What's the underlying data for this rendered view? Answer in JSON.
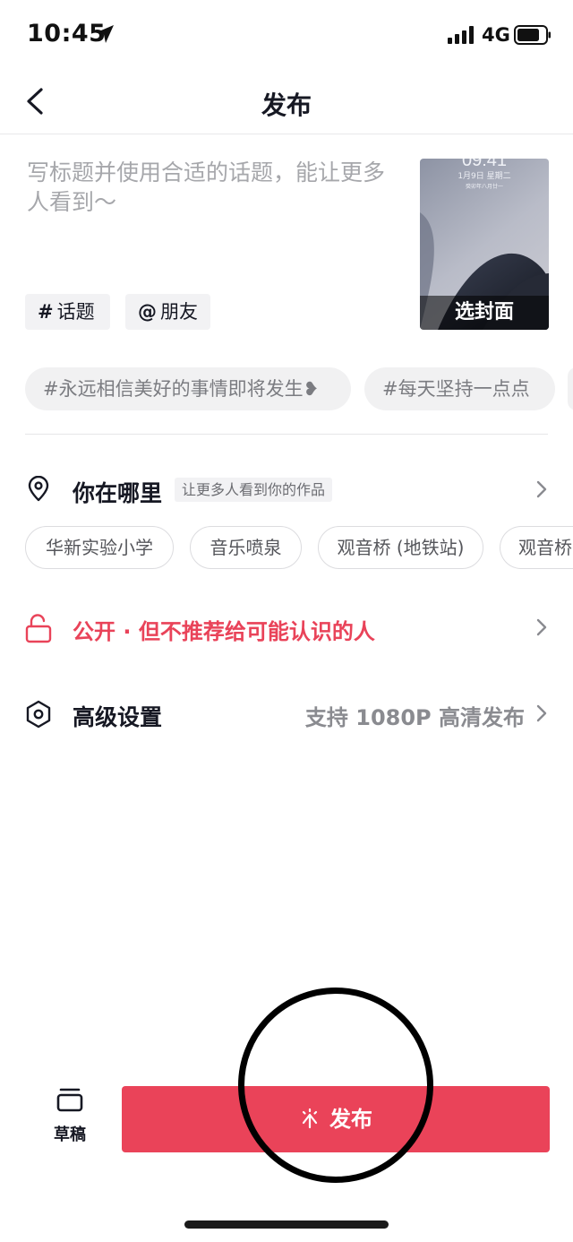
{
  "status_bar": {
    "time": "10:45",
    "network": "4G"
  },
  "nav": {
    "title": "发布"
  },
  "caption": {
    "placeholder": "写标题并使用合适的话题，能让更多人看到～"
  },
  "cover": {
    "date": "1月9日 星期二",
    "sub": "癸卯年八月廿一",
    "label": "选封面"
  },
  "tags": {
    "topic": {
      "symbol": "#",
      "label": "话题"
    },
    "friend": {
      "symbol": "@",
      "label": "朋友"
    }
  },
  "suggested_topics": [
    "#永远相信美好的事情即将发生❥",
    "#每天坚持一点点"
  ],
  "location": {
    "title": "你在哪里",
    "hint": "让更多人看到你的作品",
    "pois": [
      "华新实验小学",
      "音乐喷泉",
      "观音桥 (地铁站)",
      "观音桥"
    ]
  },
  "privacy": {
    "label": "公开 · 但不推荐给可能认识的人"
  },
  "advanced": {
    "title": "高级设置",
    "value": "支持 1080P 高清发布"
  },
  "bottom": {
    "draft_label": "草稿",
    "publish_label": "发布"
  },
  "colors": {
    "accent": "#ea4359",
    "text": "#161823",
    "muted": "#a6a7ab"
  }
}
